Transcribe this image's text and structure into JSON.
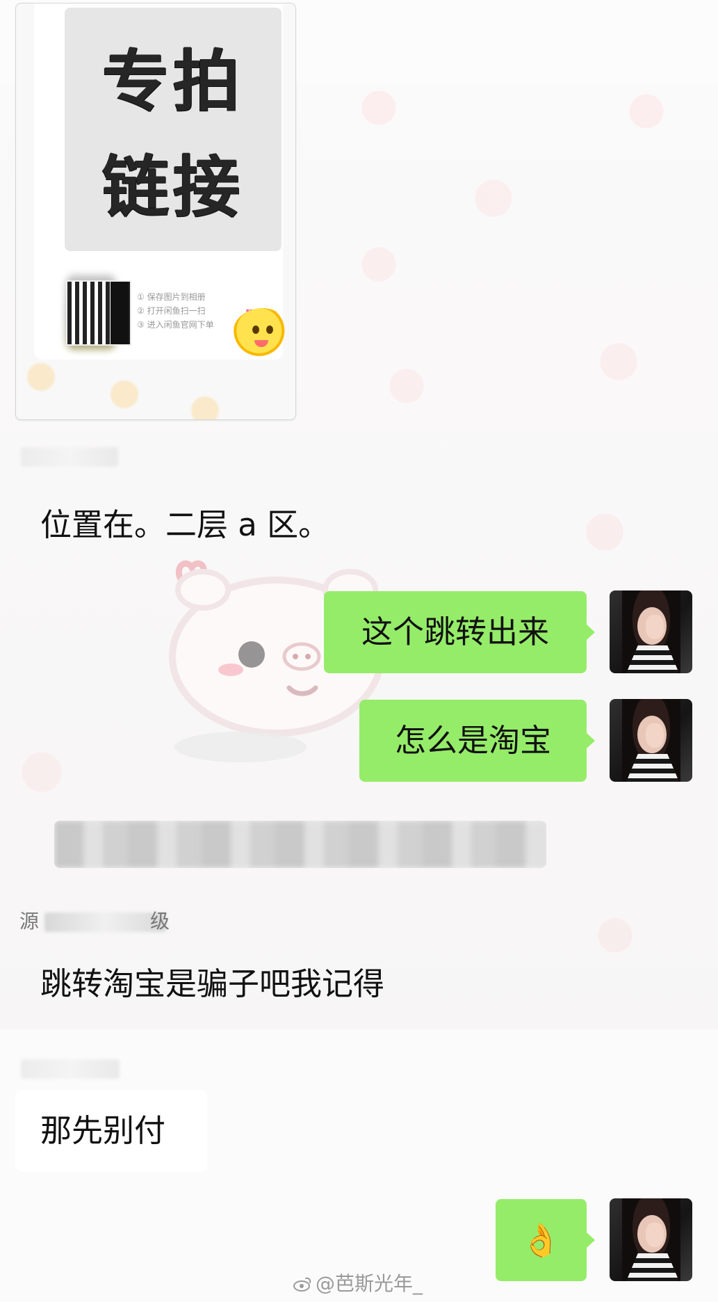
{
  "chat": {
    "image_message": {
      "poster_line_1": "专拍",
      "poster_line_2": "链接",
      "steps": [
        "① 保存图片到相册",
        "② 打开闲鱼扫一扫",
        "③ 进入闲鱼官网下单"
      ]
    },
    "messages": {
      "received_location": "位置在。二层 a 区。",
      "sent_1": "这个跳转出来",
      "sent_2": "怎么是淘宝",
      "sender_source_char": "源",
      "sender_level_char": "级",
      "received_scam_warning": "跳转淘宝是骗子吧我记得",
      "received_dont_pay": "那先别付",
      "sent_emoji": "👌"
    },
    "watermark": {
      "text": "@芭斯光年_"
    },
    "colors": {
      "sent_bubble": "#95ec69",
      "received_bubble": "#ffffff",
      "background": "#f7f5f5"
    },
    "icons": {
      "weibo": "weibo-icon",
      "avatar": "user-avatar"
    }
  }
}
